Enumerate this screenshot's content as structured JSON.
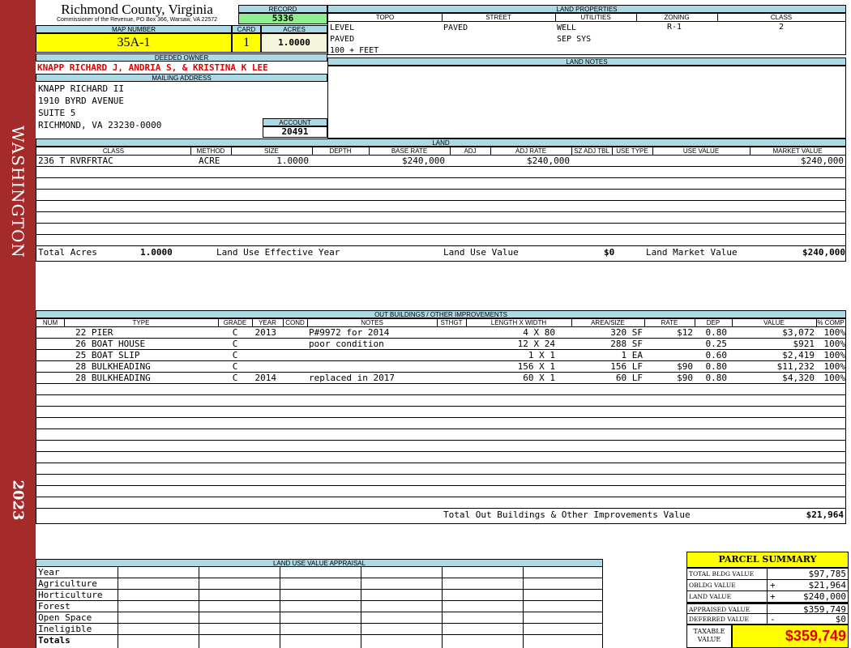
{
  "sidebar": {
    "county_name": "WASHINGTON",
    "year": "2023",
    "bg_color": "#a52a2a"
  },
  "header": {
    "title": "Richmond County, Virginia",
    "subtitle": "Commissioner of the Revenue, PO Box 366, Warsaw, VA 22572",
    "record_label": "RECORD",
    "record_value": "5336",
    "map_number_label": "MAP NUMBER",
    "map_number": "35A-1",
    "card_label": "CARD",
    "card": "1",
    "acres_label": "ACRES",
    "acres": "1.0000"
  },
  "owner": {
    "deeded_owner_label": "DEEDED OWNER",
    "deeded_owner": "KNAPP RICHARD J, ANDRIA S, & KRISTINA K LEE",
    "mailing_address_label": "MAILING ADDRESS",
    "address_lines": [
      "KNAPP RICHARD II",
      "1910 BYRD AVENUE",
      "SUITE 5",
      "RICHMOND, VA 23230-0000"
    ],
    "account_label": "ACCOUNT",
    "account": "20491"
  },
  "land_properties": {
    "title": "LAND PROPERTIES",
    "columns": [
      "TOPO",
      "STREET",
      "UTILITIES",
      "ZONING",
      "CLASS"
    ],
    "topo": [
      "LEVEL",
      "PAVED",
      "100 + FEET"
    ],
    "street": [
      "PAVED"
    ],
    "utilities": [
      "WELL",
      "SEP SYS"
    ],
    "zoning": "R-1",
    "class": "2"
  },
  "land_notes": {
    "title": "LAND NOTES"
  },
  "land": {
    "title": "LAND",
    "columns": [
      "CLASS",
      "METHOD",
      "SIZE",
      "DEPTH",
      "BASE RATE",
      "ADJ",
      "ADJ RATE",
      "SZ ADJ TBL",
      "USE TYPE",
      "USE VALUE",
      "MARKET VALUE"
    ],
    "rows": [
      {
        "class": "236 T RVRFRTAC",
        "method": "ACRE",
        "size": "1.0000",
        "depth": "",
        "base_rate": "$240,000",
        "adj": "",
        "adj_rate": "$240,000",
        "sz_adj_tbl": "",
        "use_type": "",
        "use_value": "",
        "market_value": "$240,000"
      }
    ],
    "total_acres_label": "Total Acres",
    "total_acres": "1.0000",
    "land_use_eff_year_label": "Land Use Effective Year",
    "land_use_value_label": "Land Use Value",
    "land_use_value": "$0",
    "land_market_value_label": "Land Market Value",
    "land_market_value": "$240,000"
  },
  "outbuildings": {
    "title": "OUT BUILDINGS / OTHER IMPROVEMENTS",
    "columns": [
      "NUM",
      "TYPE",
      "GRADE",
      "YEAR",
      "COND",
      "NOTES",
      "STHGT",
      "LENGTH X WIDTH",
      "AREA/SIZE",
      "RATE",
      "DEP",
      "VALUE",
      "% COMP"
    ],
    "rows": [
      {
        "type": "22 PIER",
        "grade": "C",
        "year": "2013",
        "notes": "P#9972 for 2014",
        "lw": "4 X 80",
        "area": "320 SF",
        "rate": "$12",
        "dep": "0.80",
        "value": "$3,072",
        "comp": "100%"
      },
      {
        "type": "26 BOAT HOUSE",
        "grade": "C",
        "year": "",
        "notes": "poor condition",
        "lw": "12 X 24",
        "area": "288 SF",
        "rate": "",
        "dep": "0.25",
        "value": "$921",
        "comp": "100%"
      },
      {
        "type": "25 BOAT SLIP",
        "grade": "C",
        "year": "",
        "notes": "",
        "lw": "1 X 1",
        "area": "1 EA",
        "rate": "",
        "dep": "0.60",
        "value": "$2,419",
        "comp": "100%"
      },
      {
        "type": "28 BULKHEADING",
        "grade": "C",
        "year": "",
        "notes": "",
        "lw": "156 X 1",
        "area": "156 LF",
        "rate": "$90",
        "dep": "0.80",
        "value": "$11,232",
        "comp": "100%"
      },
      {
        "type": "28 BULKHEADING",
        "grade": "C",
        "year": "2014",
        "notes": "replaced in 2017",
        "lw": "60 X 1",
        "area": "60 LF",
        "rate": "$90",
        "dep": "0.80",
        "value": "$4,320",
        "comp": "100%"
      }
    ],
    "total_label": "Total Out Buildings & Other Improvements Value",
    "total_value": "$21,964"
  },
  "land_use_appraisal": {
    "title": "LAND USE VALUE APPRAISAL",
    "year_label": "Year",
    "rows": [
      "Agriculture",
      "Horticulture",
      "Forest",
      "Open Space",
      "Ineligible"
    ],
    "totals_label": "Totals"
  },
  "parcel_summary": {
    "title": "PARCEL SUMMARY",
    "rows": [
      {
        "label": "TOTAL BLDG VALUE",
        "sign": "",
        "value": "$97,785"
      },
      {
        "label": "OBLDG VALUE",
        "sign": "+",
        "value": "$21,964"
      },
      {
        "label": "LAND VALUE",
        "sign": "+",
        "value": "$240,000"
      },
      {
        "label": "APPRAISED VALUE",
        "sign": "",
        "value": "$359,749"
      },
      {
        "label": "DEFERRED VALUE",
        "sign": "-",
        "value": "$0"
      }
    ],
    "taxable_label": "TAXABLE VALUE",
    "taxable_value": "$359,749"
  }
}
